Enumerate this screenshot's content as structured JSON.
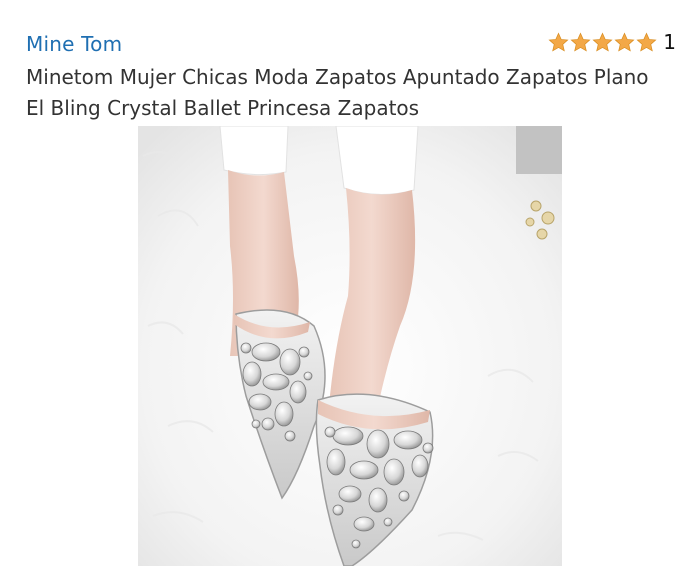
{
  "product": {
    "brand": "Mine Tom",
    "title": "Minetom Mujer Chicas Moda Zapatos Apuntado Zapatos Plano El Bling Crystal Ballet Princesa Zapatos",
    "rating": {
      "stars": 5,
      "max_stars": 5,
      "count": "1",
      "star_color": "#f3a847"
    },
    "image": {
      "icon": "product-photo-silver-rhinestone-flats"
    }
  },
  "colors": {
    "brand_link": "#1f6fb2",
    "title_text": "#333333"
  }
}
